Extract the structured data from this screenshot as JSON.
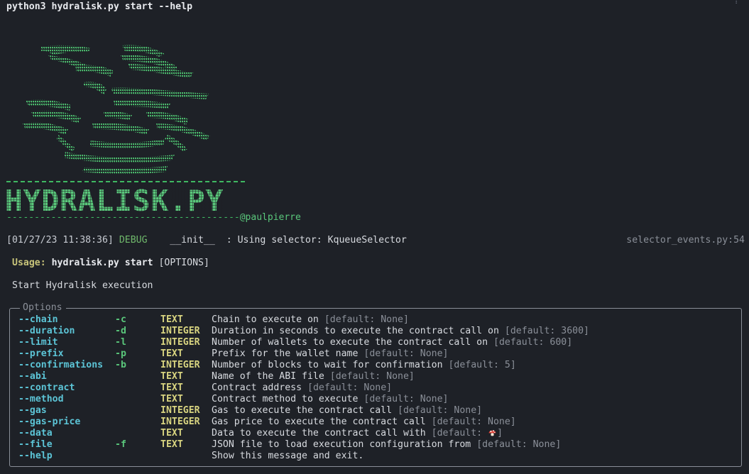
{
  "terminal": {
    "command": "python3 hydralisk.py start --help",
    "overflow_glyph": "⁞"
  },
  "banner": {
    "wordmark": "HYDRALISK.PY",
    "handle": "@paulpierre",
    "colors": {
      "primary": "#5ac77b",
      "dark": "#3fb862",
      "bg": "#1e2127"
    }
  },
  "log": {
    "timestamp": "[01/27/23 11:38:36]",
    "level": "DEBUG",
    "module": "__init__",
    "message": ": Using selector: KqueueSelector",
    "source": "selector_events.py:54"
  },
  "usage": {
    "label": "Usage:",
    "prog": "hydralisk.py start",
    "args": "[OPTIONS]"
  },
  "description": "Start Hydralisk execution",
  "options_panel": {
    "title": "Options",
    "rows": [
      {
        "name": "--chain",
        "short": "-c",
        "type": "TEXT",
        "help": "Chain to execute on",
        "default": "[default: None]"
      },
      {
        "name": "--duration",
        "short": "-d",
        "type": "INTEGER",
        "help": "Duration in seconds to execute the contract call on",
        "default": "[default: 3600]"
      },
      {
        "name": "--limit",
        "short": "-l",
        "type": "INTEGER",
        "help": "Number of wallets to execute the contract call on",
        "default": "[default: 600]"
      },
      {
        "name": "--prefix",
        "short": "-p",
        "type": "TEXT",
        "help": "Prefix for the wallet name",
        "default": "[default: None]"
      },
      {
        "name": "--confirmations",
        "short": "-b",
        "type": "INTEGER",
        "help": "Number of blocks to wait for confirmation",
        "default": "[default: 5]"
      },
      {
        "name": "--abi",
        "short": "",
        "type": "TEXT",
        "help": "Name of the ABI file",
        "default": "[default: None]"
      },
      {
        "name": "--contract",
        "short": "",
        "type": "TEXT",
        "help": "Contract address",
        "default": "[default: None]"
      },
      {
        "name": "--method",
        "short": "",
        "type": "TEXT",
        "help": "Contract method to execute",
        "default": "[default: None]"
      },
      {
        "name": "--gas",
        "short": "",
        "type": "INTEGER",
        "help": "Gas to execute the contract call",
        "default": "[default: None]"
      },
      {
        "name": "--gas-price",
        "short": "",
        "type": "INTEGER",
        "help": "Gas price to execute the contract call",
        "default": "[default: None]"
      },
      {
        "name": "--data",
        "short": "",
        "type": "TEXT",
        "help": "Data to execute the contract call with",
        "default": "[default: ",
        "default_icon": "mushroom-icon",
        "default_tail": "]"
      },
      {
        "name": "--file",
        "short": "-f",
        "type": "TEXT",
        "help": "JSON file to load execution configuration from",
        "default": "[default: None]"
      },
      {
        "name": "--help",
        "short": "",
        "type": "",
        "help": "Show this message and exit.",
        "default": ""
      }
    ]
  }
}
